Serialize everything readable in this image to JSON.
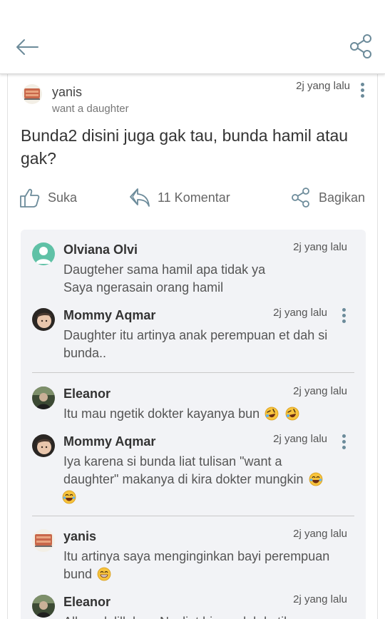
{
  "post": {
    "author": "yanis",
    "subtitle": "want a daughter",
    "time": "2j yang lalu",
    "text": "Bunda2 disini juga gak tau, bunda hamil atau gak?"
  },
  "actions": {
    "like": "Suka",
    "comments": "11 Komentar",
    "share": "Bagikan"
  },
  "comments": [
    {
      "name": "Olviana Olvi",
      "time": "2j yang lalu",
      "line1": "Daugteher sama hamil apa tidak ya",
      "line2": "Saya ngerasain orang hamil"
    },
    {
      "name": "Mommy Aqmar",
      "time": "2j yang lalu",
      "line1": "Daughter itu artinya anak perempuan et dah si",
      "line2": "bunda.."
    },
    {
      "name": "Eleanor",
      "time": "2j yang lalu",
      "line1": "Itu mau ngetik dokter kayanya bun"
    },
    {
      "name": "Mommy Aqmar",
      "time": "2j yang lalu",
      "line1": "Iya karena si bunda liat tulisan \"want a",
      "line2": "daughter\" makanya di kira dokter mungkin"
    },
    {
      "name": "yanis",
      "time": "2j yang lalu",
      "line1": "Itu artinya saya menginginkan bayi perempuan",
      "line2": "bund"
    },
    {
      "name": "Eleanor",
      "time": "2j yang lalu",
      "line1": "Alhamdulillah … Nyaliat bisa salah ketik"
    }
  ],
  "icons": {
    "back": "arrow-left-icon",
    "share": "share-icon",
    "like": "thumbs-up-icon",
    "comment": "reply-arrow-icon",
    "menu": "more-vertical-icon",
    "emoji_rofl": "rolling-laughing-emoji",
    "emoji_joy": "tears-of-joy-emoji",
    "emoji_grin": "grinning-emoji"
  },
  "colors": {
    "accent": "#6c8b9a",
    "comment_bg": "#f2f3f6",
    "avatar_teal": "#5fc1a6"
  }
}
